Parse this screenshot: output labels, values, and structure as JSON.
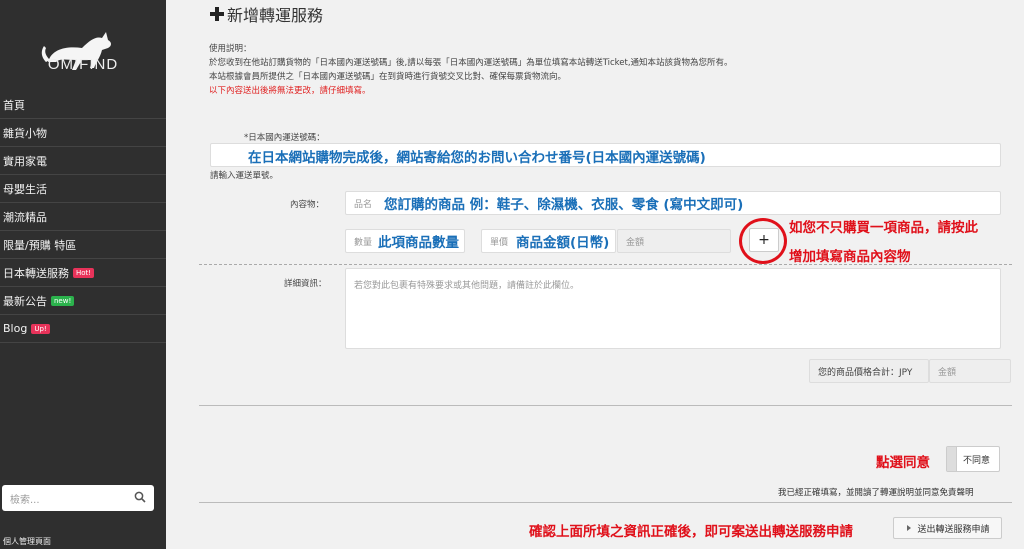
{
  "sidebar": {
    "brand": "OMIFIND",
    "nav": [
      {
        "label": "首頁",
        "badge": "",
        "badge_color": ""
      },
      {
        "label": "雜貨小物",
        "badge": "",
        "badge_color": ""
      },
      {
        "label": "實用家電",
        "badge": "",
        "badge_color": ""
      },
      {
        "label": "母嬰生活",
        "badge": "",
        "badge_color": ""
      },
      {
        "label": "潮流精品",
        "badge": "",
        "badge_color": ""
      },
      {
        "label": "限量/預購 特區",
        "badge": "",
        "badge_color": ""
      },
      {
        "label": "日本轉送服務",
        "badge": "Hot!",
        "badge_color": "#e8335a"
      },
      {
        "label": "最新公告",
        "badge": "new!",
        "badge_color": "#2bb24c"
      },
      {
        "label": "Blog",
        "badge": "Up!",
        "badge_color": "#e8335a"
      }
    ],
    "search_placeholder": "檢索...",
    "admin_label": "個人管理頁面"
  },
  "main": {
    "title": "新增轉運服務",
    "instructions": {
      "heading": "使用説明：",
      "line1": "於您收到在他站訂購貨物的「日本國內運送號碼」後,請以每張「日本國內運送號碼」為單位填寫本站轉送Ticket,通知本站該貨物為您所有。",
      "line2": "本站根據會員所提供之「日本國內運送號碼」在到貨時進行貨號交叉比對、確保每票貨物流向。",
      "warning": "以下內容送出後將無法更改，請仔細填寫。"
    },
    "tracking": {
      "label": "*日本國內運送號碼：",
      "annotation": "在日本網站購物完成後，網站寄給您的お問い合わせ番号(日本國內運送號碼)",
      "hint": "請輸入運送單號。"
    },
    "contents": {
      "label": "內容物：",
      "name_placeholder": "品名",
      "name_annotation": "您訂購的商品  例：鞋子、除濕機、衣服、零食  (寫中文即可)",
      "qty_placeholder": "數量",
      "qty_annotation": "此項商品數量",
      "price_placeholder": "單價",
      "price_annotation": "商品金額(日幣)",
      "amount_placeholder": "金額",
      "add_symbol": "+",
      "add_annotation_1": "如您不只購買一項商品，請按此",
      "add_annotation_2": "增加填寫商品內容物"
    },
    "details": {
      "label": "詳細資訊：",
      "placeholder": "若您對此包裹有特殊要求或其他問題，請備註於此欄位。"
    },
    "total": {
      "label": "您的商品價格合計：JPY",
      "placeholder": "金額"
    },
    "agree": {
      "annotation": "點選同意",
      "toggle_label": "不同意",
      "note": "我已經正確填寫，並閱讀了轉運說明並同意免責聲明"
    },
    "submit": {
      "annotation": "確認上面所填之資訊正確後，即可案送出轉送服務申請",
      "label": "送出轉送服務申請"
    }
  },
  "colors": {
    "sidebar_bg": "#2f2f2f",
    "annotation_blue": "#1a6fb8",
    "annotation_red": "#e0101a",
    "page_bg": "#f1f1f1"
  }
}
